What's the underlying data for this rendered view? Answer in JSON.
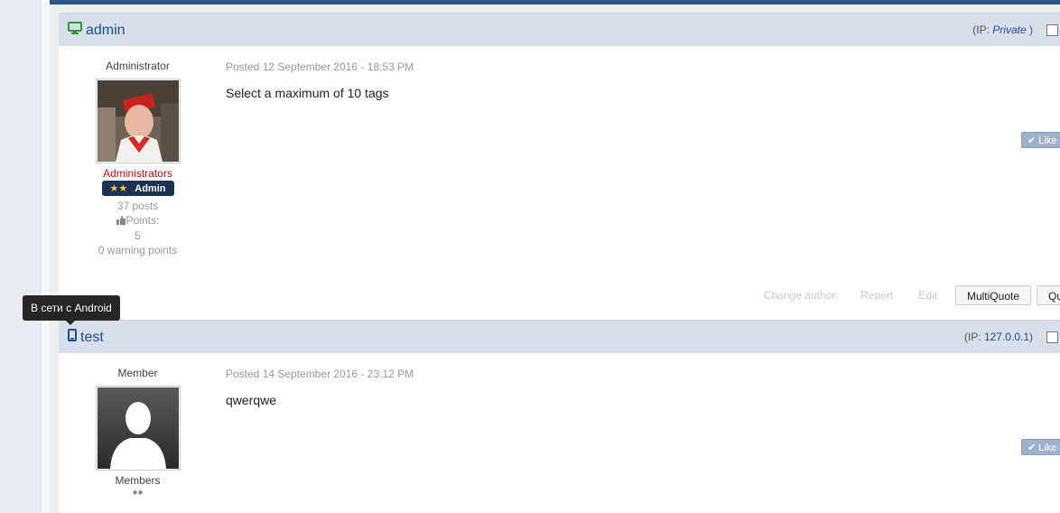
{
  "posts": [
    {
      "author": "admin",
      "device_icon": "desktop-icon",
      "ip_prefix": "(IP: ",
      "ip_value": "Private",
      "ip_suffix": " )",
      "role": "Administrator",
      "group": "Administrators",
      "rank": "Admin",
      "posts_count": "37 posts",
      "points_label": "Points:",
      "points_value": "5",
      "warning_points": "0 warning points",
      "posted": "Posted 12 September 2016 - 18:53 PM",
      "content": "Select a maximum of 10 tags",
      "like_label": "Like"
    },
    {
      "author": "test",
      "device_icon": "mobile-phone-icon",
      "ip_prefix": "(IP: ",
      "ip_value": "127.0.0.1",
      "ip_suffix": ")",
      "role": "Member",
      "group": "Members",
      "posted": "Posted 14 September 2016 - 23:12 PM",
      "content": "qwerqwe",
      "like_label": "Like"
    }
  ],
  "controls": {
    "change_author": "Change author",
    "report": "Report",
    "edit": "Edit",
    "multiquote": "MultiQuote",
    "quote": "Quote"
  },
  "tooltip": "В сети с Android",
  "colors": {
    "top_bar": "#2c5287",
    "post_header": "#d8dfea",
    "admin_group": "#c01010",
    "rank_badge": "#1c3252",
    "link": "#1d4f91"
  }
}
